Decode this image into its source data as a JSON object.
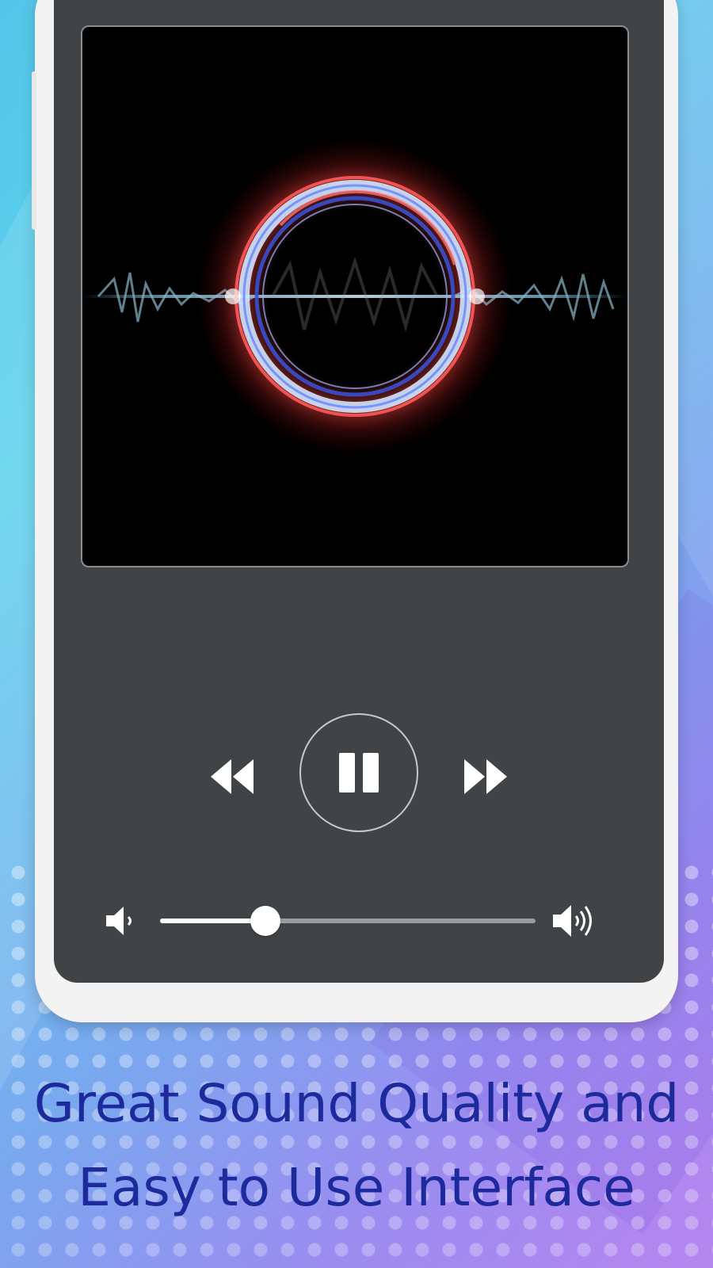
{
  "caption": {
    "line1": "Great Sound Quality and",
    "line2": "Easy to Use Interface"
  },
  "player": {
    "state": "playing",
    "volume_level": 0.28,
    "icons": {
      "rewind": "rewind-icon",
      "pause": "pause-icon",
      "forward": "fast-forward-icon",
      "volume_low": "volume-low-icon",
      "volume_high": "volume-high-icon"
    }
  },
  "colors": {
    "caption_text": "#1d2a9c",
    "screen_bg": "#414446",
    "control_icon": "#ffffff",
    "slider_fill": "#ffffff",
    "slider_track": "#9a9c9e"
  }
}
